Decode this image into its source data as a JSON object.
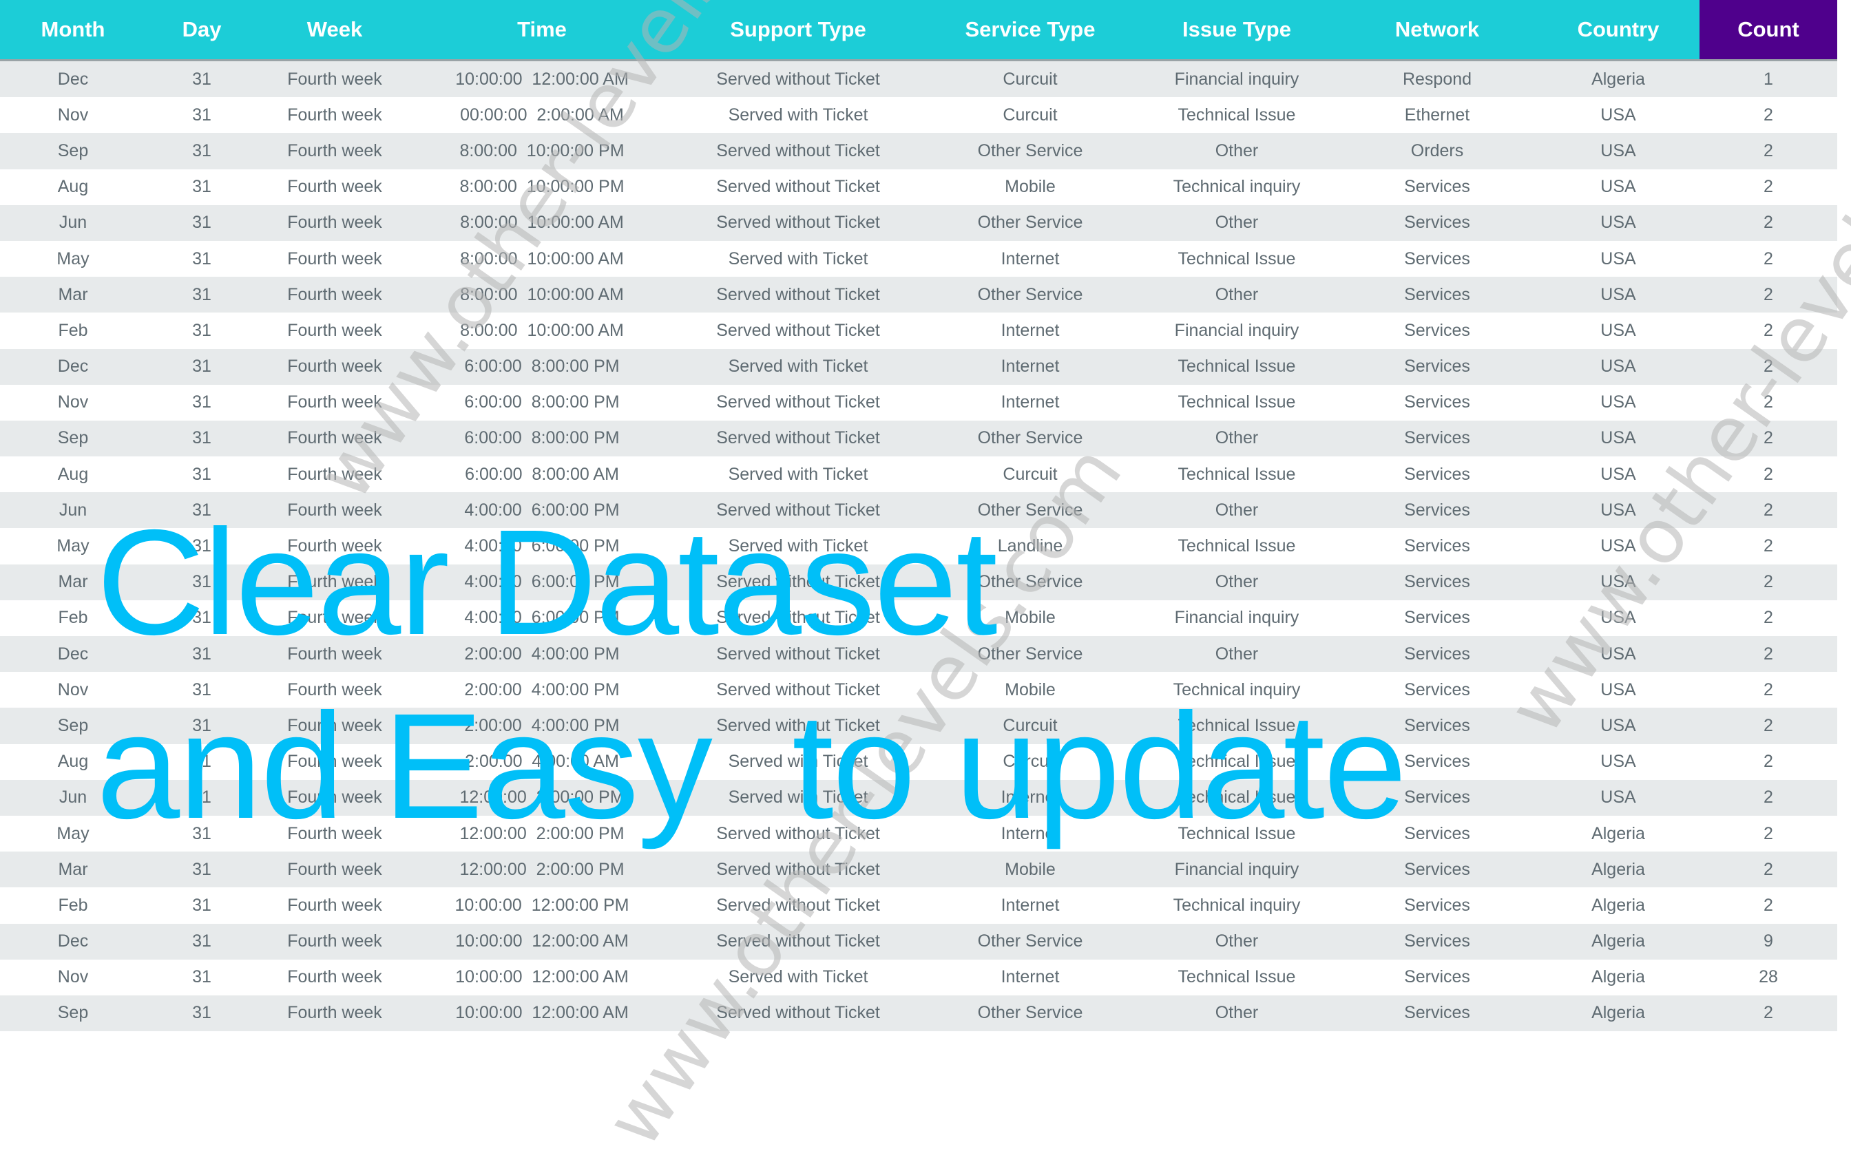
{
  "table": {
    "headers": [
      "Month",
      "Day",
      "Week",
      "Time",
      "Support Type",
      "Service Type",
      "Issue Type",
      "Network",
      "Country",
      "Count"
    ],
    "rows": [
      [
        "Dec",
        "31",
        "Fourth week",
        "10:00:00  12:00:00 AM",
        "Served without Ticket",
        "Curcuit",
        "Financial inquiry",
        "Respond",
        "Algeria",
        "1"
      ],
      [
        "Nov",
        "31",
        "Fourth week",
        "00:00:00  2:00:00 AM",
        "Served with Ticket",
        "Curcuit",
        "Technical Issue",
        "Ethernet",
        "USA",
        "2"
      ],
      [
        "Sep",
        "31",
        "Fourth week",
        "8:00:00  10:00:00 PM",
        "Served without Ticket",
        "Other Service",
        "Other",
        "Orders",
        "USA",
        "2"
      ],
      [
        "Aug",
        "31",
        "Fourth week",
        "8:00:00  10:00:00 PM",
        "Served without Ticket",
        "Mobile",
        "Technical inquiry",
        "Services",
        "USA",
        "2"
      ],
      [
        "Jun",
        "31",
        "Fourth week",
        "8:00:00  10:00:00 AM",
        "Served without Ticket",
        "Other Service",
        "Other",
        "Services",
        "USA",
        "2"
      ],
      [
        "May",
        "31",
        "Fourth week",
        "8:00:00  10:00:00 AM",
        "Served with Ticket",
        "Internet",
        "Technical Issue",
        "Services",
        "USA",
        "2"
      ],
      [
        "Mar",
        "31",
        "Fourth week",
        "8:00:00  10:00:00 AM",
        "Served without Ticket",
        "Other Service",
        "Other",
        "Services",
        "USA",
        "2"
      ],
      [
        "Feb",
        "31",
        "Fourth week",
        "8:00:00  10:00:00 AM",
        "Served without Ticket",
        "Internet",
        "Financial inquiry",
        "Services",
        "USA",
        "2"
      ],
      [
        "Dec",
        "31",
        "Fourth week",
        "6:00:00  8:00:00 PM",
        "Served with Ticket",
        "Internet",
        "Technical Issue",
        "Services",
        "USA",
        "2"
      ],
      [
        "Nov",
        "31",
        "Fourth week",
        "6:00:00  8:00:00 PM",
        "Served without Ticket",
        "Internet",
        "Technical Issue",
        "Services",
        "USA",
        "2"
      ],
      [
        "Sep",
        "31",
        "Fourth week",
        "6:00:00  8:00:00 PM",
        "Served without Ticket",
        "Other Service",
        "Other",
        "Services",
        "USA",
        "2"
      ],
      [
        "Aug",
        "31",
        "Fourth week",
        "6:00:00  8:00:00 AM",
        "Served with Ticket",
        "Curcuit",
        "Technical Issue",
        "Services",
        "USA",
        "2"
      ],
      [
        "Jun",
        "31",
        "Fourth week",
        "4:00:00  6:00:00 PM",
        "Served without Ticket",
        "Other Service",
        "Other",
        "Services",
        "USA",
        "2"
      ],
      [
        "May",
        "31",
        "Fourth week",
        "4:00:00  6:00:00 PM",
        "Served with Ticket",
        "Landline",
        "Technical Issue",
        "Services",
        "USA",
        "2"
      ],
      [
        "Mar",
        "31",
        "Fourth week",
        "4:00:00  6:00:00 PM",
        "Served without Ticket",
        "Other Service",
        "Other",
        "Services",
        "USA",
        "2"
      ],
      [
        "Feb",
        "31",
        "Fourth week",
        "4:00:00  6:00:00 PM",
        "Served without Ticket",
        "Mobile",
        "Financial inquiry",
        "Services",
        "USA",
        "2"
      ],
      [
        "Dec",
        "31",
        "Fourth week",
        "2:00:00  4:00:00 PM",
        "Served without Ticket",
        "Other Service",
        "Other",
        "Services",
        "USA",
        "2"
      ],
      [
        "Nov",
        "31",
        "Fourth week",
        "2:00:00  4:00:00 PM",
        "Served without Ticket",
        "Mobile",
        "Technical inquiry",
        "Services",
        "USA",
        "2"
      ],
      [
        "Sep",
        "31",
        "Fourth week",
        "2:00:00  4:00:00 PM",
        "Served without Ticket",
        "Curcuit",
        "Technical Issue",
        "Services",
        "USA",
        "2"
      ],
      [
        "Aug",
        "31",
        "Fourth week",
        "2:00:00  4:00:00 AM",
        "Served with Ticket",
        "Curcuit",
        "Technical Issue",
        "Services",
        "USA",
        "2"
      ],
      [
        "Jun",
        "31",
        "Fourth week",
        "12:00:00  2:00:00 PM",
        "Served with Ticket",
        "Internet",
        "Technical Issue",
        "Services",
        "USA",
        "2"
      ],
      [
        "May",
        "31",
        "Fourth week",
        "12:00:00  2:00:00 PM",
        "Served without Ticket",
        "Internet",
        "Technical Issue",
        "Services",
        "Algeria",
        "2"
      ],
      [
        "Mar",
        "31",
        "Fourth week",
        "12:00:00  2:00:00 PM",
        "Served without Ticket",
        "Mobile",
        "Financial inquiry",
        "Services",
        "Algeria",
        "2"
      ],
      [
        "Feb",
        "31",
        "Fourth week",
        "10:00:00  12:00:00 PM",
        "Served without Ticket",
        "Internet",
        "Technical inquiry",
        "Services",
        "Algeria",
        "2"
      ],
      [
        "Dec",
        "31",
        "Fourth week",
        "10:00:00  12:00:00 AM",
        "Served without Ticket",
        "Other Service",
        "Other",
        "Services",
        "Algeria",
        "9"
      ],
      [
        "Nov",
        "31",
        "Fourth week",
        "10:00:00  12:00:00 AM",
        "Served with Ticket",
        "Internet",
        "Technical Issue",
        "Services",
        "Algeria",
        "28"
      ],
      [
        "Sep",
        "31",
        "Fourth week",
        "10:00:00  12:00:00 AM",
        "Served without Ticket",
        "Other Service",
        "Other",
        "Services",
        "Algeria",
        "2"
      ]
    ]
  },
  "overlay": {
    "line1": "Clear Dataset",
    "line2": "and Easy  to update"
  },
  "watermark": "www.other-levels.com",
  "colors": {
    "header_bg": "#1ccdd7",
    "count_header_bg": "#4f008c",
    "row_alt_bg": "#e7eaeb",
    "cell_text": "#5f6b72",
    "overlay_text": "#00bff8"
  }
}
